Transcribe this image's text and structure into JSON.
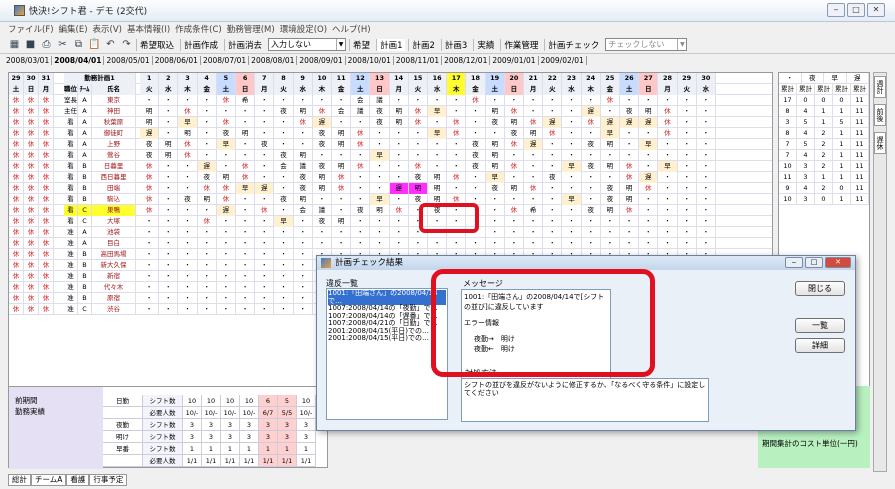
{
  "title": "快決!シフト君 - デモ (2交代)",
  "menu": [
    "ファイル(F)",
    "編集(E)",
    "表示(V)",
    "基本情報(I)",
    "作成条件(C)",
    "勤務管理(M)",
    "環境設定(O)",
    "ヘルプ(H)"
  ],
  "toolbar": {
    "kibou": "希望取込",
    "keikaku": "計画作成",
    "shoukyo": "計画消去",
    "input_sel": "入力しない",
    "kibou2": "希望",
    "keikaku1": "計画1",
    "keikaku2": "計画2",
    "keikaku3": "計画3",
    "jisseki": "実績",
    "sagyo": "作業管理",
    "check": "計画チェック",
    "check_sel": "チェックしない"
  },
  "months": [
    "2008/03/01",
    "2008/04/01",
    "2008/05/01",
    "2008/06/01",
    "2008/07/01",
    "2008/08/01",
    "2008/09/01",
    "2008/10/01",
    "2008/11/01",
    "2008/12/01",
    "2009/01/01",
    "2009/02/01"
  ],
  "grid": {
    "top_left_days": [
      "29",
      "30",
      "31"
    ],
    "top_left_dows": [
      "土",
      "日",
      "月"
    ],
    "plan_label": "勤務計画1",
    "col_role": "職位",
    "col_team": "ﾁｰﾑ",
    "col_name": "氏名",
    "days": [
      "1",
      "2",
      "3",
      "4",
      "5",
      "6",
      "7",
      "8",
      "9",
      "10",
      "11",
      "12",
      "13",
      "14",
      "15",
      "16",
      "17",
      "18",
      "19",
      "20",
      "21",
      "22",
      "23",
      "24",
      "25",
      "26",
      "27",
      "28",
      "29",
      "30"
    ],
    "dows": [
      "火",
      "水",
      "木",
      "金",
      "土",
      "日",
      "月",
      "火",
      "水",
      "木",
      "金",
      "土",
      "日",
      "月",
      "火",
      "水",
      "木",
      "金",
      "土",
      "日",
      "月",
      "火",
      "水",
      "木",
      "金",
      "土",
      "日",
      "月",
      "火",
      "水"
    ],
    "staff": [
      {
        "role": "室長",
        "team": "A",
        "name": "東京"
      },
      {
        "role": "主任",
        "team": "A",
        "name": "神田"
      },
      {
        "role": "看",
        "team": "A",
        "name": "秋葉原"
      },
      {
        "role": "看",
        "team": "A",
        "name": "御徒町"
      },
      {
        "role": "看",
        "team": "A",
        "name": "上野"
      },
      {
        "role": "看",
        "team": "A",
        "name": "鶯谷"
      },
      {
        "role": "看",
        "team": "B",
        "name": "日暮里"
      },
      {
        "role": "看",
        "team": "B",
        "name": "西日暮里"
      },
      {
        "role": "看",
        "team": "B",
        "name": "田端"
      },
      {
        "role": "看",
        "team": "B",
        "name": "駒込"
      },
      {
        "role": "看",
        "team": "C",
        "name": "巣鴨"
      },
      {
        "role": "看",
        "team": "C",
        "name": "大塚"
      },
      {
        "role": "准",
        "team": "A",
        "name": "池袋"
      },
      {
        "role": "准",
        "team": "A",
        "name": "目白"
      },
      {
        "role": "准",
        "team": "B",
        "name": "高田馬場"
      },
      {
        "role": "准",
        "team": "B",
        "name": "新大久保"
      },
      {
        "role": "准",
        "team": "B",
        "name": "新宿"
      },
      {
        "role": "准",
        "team": "B",
        "name": "代々木"
      },
      {
        "role": "准",
        "team": "B",
        "name": "原宿"
      },
      {
        "role": "准",
        "team": "C",
        "name": "渋谷"
      }
    ],
    "shift_rows": [
      "・・・・休希・・・・・会議・・・・休・・・・・・休・・・・",
      "明・休・・・・夜明休会議夜明休早・・明休・・・遅・夜明休",
      "明・早・休・・・休遅・・夜明休・休・夜明休遅・休遅遅遅休",
      "遅・明・夜明・・・夜明休・・・早休・・夜明休・・早・・休",
      "夜明休・早・夜・・夜明休・・・・・夜明休遅・・夜明・早",
      "夜明休・・・・夜明・・・早・・・・夜明・・・・・・・・",
      "休・・遅・休・会議夜明休・・休・・夜明休・・早夜明休・早",
      "休・・夜明休・・夜明休・・・夜明休・早・・夜・・・休遅",
      "休・・休休早遅・夜明休・・・遅明・・夜明休・・・夜明休",
      "休・夜明休・・夜明・・・早・夜明休・・・・・早・夜明・",
      "休・・・遅・休・会議・夜明休・夜・・・休希・・夜明休・・",
      "・・・休・・・早・夜明・・・・・・・・・・・・・・・・"
    ],
    "rp_hdr": [
      "・",
      "夜",
      "早",
      "遅"
    ],
    "rp_sub": [
      "累計",
      "累計",
      "累計",
      "累計",
      "累計"
    ],
    "rp_rows": [
      [
        "17",
        "0",
        "0",
        "0",
        "11"
      ],
      [
        "8",
        "4",
        "1",
        "1",
        "11"
      ],
      [
        "3",
        "5",
        "1",
        "5",
        "11"
      ],
      [
        "8",
        "4",
        "2",
        "1",
        "11"
      ],
      [
        "7",
        "5",
        "2",
        "1",
        "11"
      ],
      [
        "7",
        "4",
        "2",
        "1",
        "11"
      ],
      [
        "10",
        "3",
        "2",
        "1",
        "11"
      ],
      [
        "11",
        "3",
        "1",
        "1",
        "11"
      ],
      [
        "9",
        "4",
        "2",
        "0",
        "11"
      ],
      [
        "10",
        "3",
        "0",
        "1",
        "11"
      ]
    ]
  },
  "side_tabs": [
    "週計",
    "前後",
    "遅休"
  ],
  "bottom": {
    "period_label": "前期間",
    "actual_label": "勤務実績",
    "rows": [
      {
        "cat": "日勤",
        "type": "シフト数",
        "vals": [
          "10",
          "10",
          "10",
          "10",
          "6",
          "5",
          "10"
        ]
      },
      {
        "cat": "",
        "type": "必要人数",
        "vals": [
          "10/-",
          "10/-",
          "10/-",
          "10/-",
          "6/7",
          "5/5",
          "10/-"
        ]
      },
      {
        "cat": "夜勤",
        "type": "シフト数",
        "vals": [
          "3",
          "3",
          "3",
          "3",
          "3",
          "3",
          "3"
        ]
      },
      {
        "cat": "明け",
        "type": "シフト数",
        "vals": [
          "3",
          "3",
          "3",
          "3",
          "3",
          "3",
          "3"
        ]
      },
      {
        "cat": "早番",
        "type": "シフト数",
        "vals": [
          "1",
          "1",
          "1",
          "1",
          "1",
          "1",
          "1"
        ]
      },
      {
        "cat": "",
        "type": "必要人数",
        "vals": [
          "1/1",
          "1/1",
          "1/1",
          "1/1",
          "1/1",
          "1/1",
          "1/1"
        ]
      }
    ],
    "cost_label": "期間集計のコスト単位(一円)"
  },
  "tabs": [
    "総計",
    "チームA",
    "看護",
    "行事予定"
  ],
  "dialog": {
    "title": "計画チェック結果",
    "list_label": "違反一覧",
    "list": [
      "1001:「田端さん」の2008/04/14で…",
      "1007:2008/04/14の「夜勤」で…",
      "1007:2008/04/14の「遅番」で…",
      "1007:2008/04/21の「日勤」で…",
      "2001:2008/04/15(平日)での…",
      "2001:2008/04/15(平日)での…"
    ],
    "msg_label": "メッセージ",
    "msg": "1001:「田端さん」の2008/04/14で[シフトの並び]に違反しています",
    "err_label": "エラー情報",
    "err_line1": "夜勤→　明け",
    "err_line2": "夜勤←　明け",
    "fix_label": "対処方法",
    "fix": "シフトの並びを違反がないように修正するか、「なるべく守る条件」に設定してください",
    "close": "閉じる",
    "list_btn": "一覧",
    "detail_btn": "詳細"
  },
  "highlight": [
    "遅",
    "明"
  ],
  "colors": {
    "red": "#e01020",
    "magenta": "#ff30ff",
    "yellow": "#ffff30",
    "blue_sel": "#3470d0"
  }
}
